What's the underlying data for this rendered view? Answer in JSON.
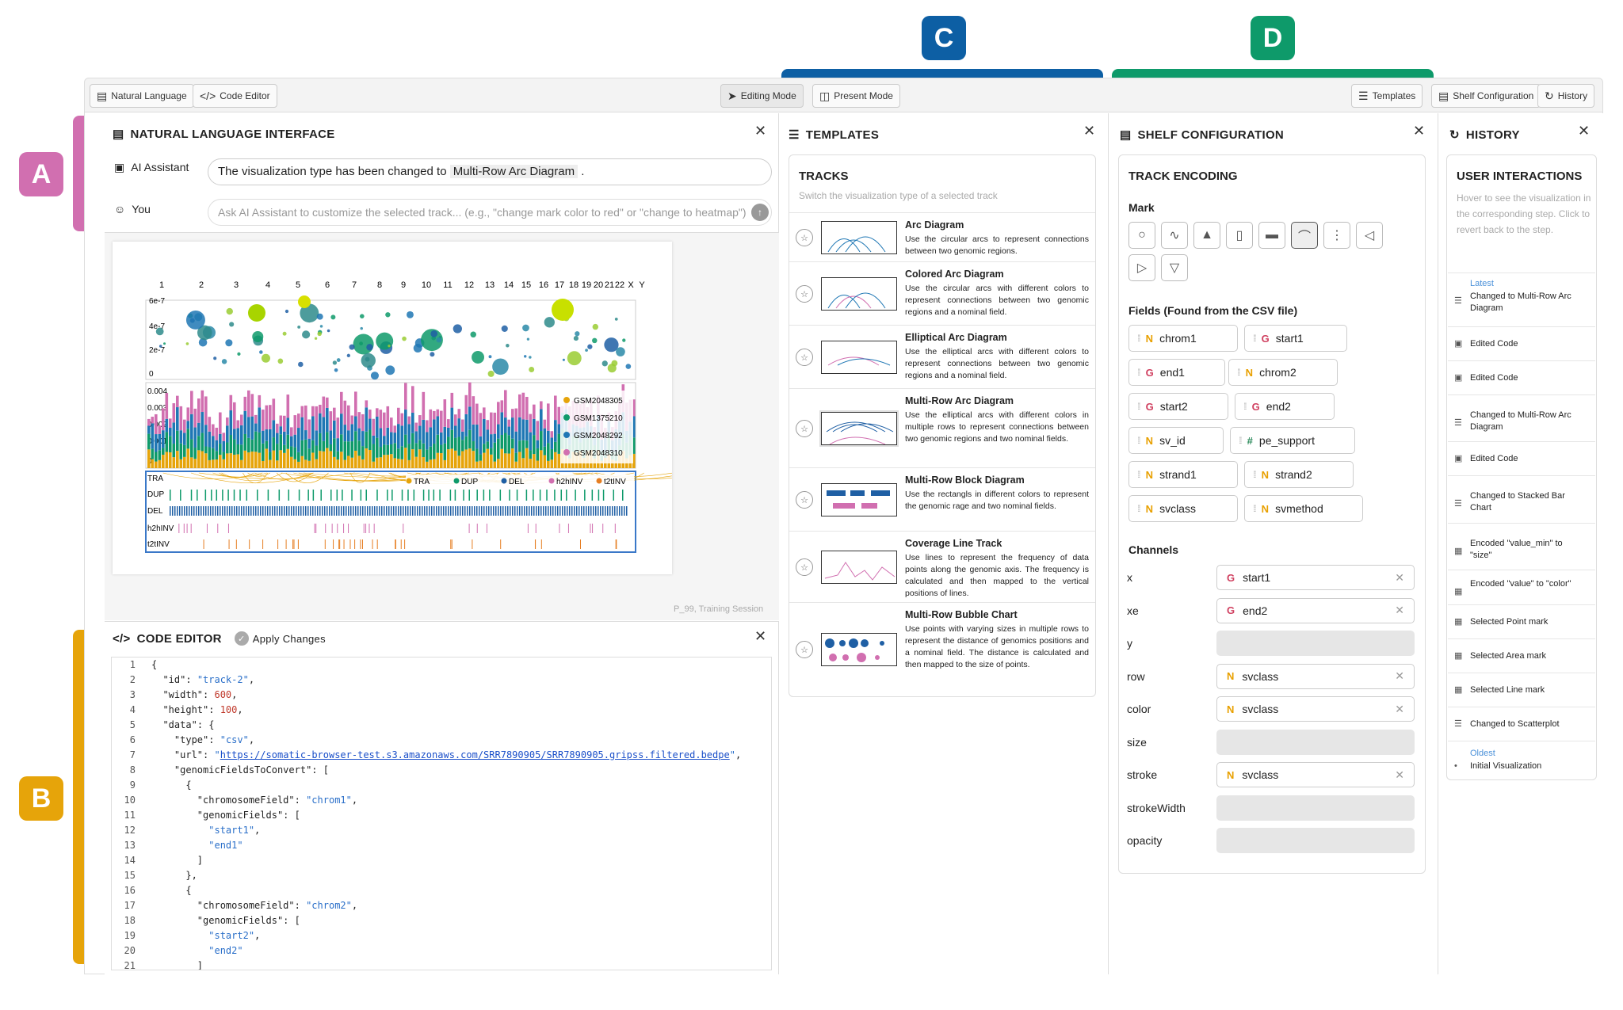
{
  "badges": {
    "a": "A",
    "b": "B",
    "c": "C",
    "d": "D"
  },
  "colors": {
    "pink": "#d16fb0",
    "orange": "#e6a40a",
    "blue": "#0d5fa4",
    "green": "#0e9a6a"
  },
  "toolbar": {
    "natural_language": "Natural Language",
    "code_editor": "Code Editor",
    "editing_mode": "Editing Mode",
    "present_mode": "Present Mode",
    "templates": "Templates",
    "shelf_configuration": "Shelf Configuration",
    "history": "History"
  },
  "nli": {
    "title": "NATURAL LANGUAGE INTERFACE",
    "assistant_label": "AI Assistant",
    "assistant_message_prefix": "The visualization type has been changed to",
    "assistant_message_highlight": "Multi-Row Arc Diagram",
    "assistant_message_suffix": ".",
    "you_label": "You",
    "input_placeholder": "Ask AI Assistant to customize the selected track... (e.g., \"change mark color to red\" or \"change to heatmap\")",
    "session_label": "P_99, Training Session"
  },
  "viz": {
    "chrom_ticks": [
      "1",
      "2",
      "3",
      "4",
      "5",
      "6",
      "7",
      "8",
      "9",
      "10",
      "11",
      "12",
      "13",
      "14",
      "15",
      "16",
      "17",
      "18",
      "19",
      "20",
      "21",
      "22",
      "X",
      "Y"
    ],
    "bubble_y_ticks": [
      "6e-7",
      "4e-7",
      "2e-7",
      "0"
    ],
    "bar_y_ticks": [
      "0.004",
      "0.003",
      "0.002",
      "0.001",
      "0"
    ],
    "bar_legend": [
      "GSM2048305",
      "GSM1375210",
      "GSM2048292",
      "GSM2048310"
    ],
    "bar_legend_colors": [
      "#e6a40a",
      "#0e9a6a",
      "#1f77b4",
      "#d16fb0"
    ],
    "arc_legend": [
      "TRA",
      "DUP",
      "DEL",
      "h2hINV",
      "t2tINV"
    ],
    "arc_legend_colors": [
      "#e6a40a",
      "#0e9a6a",
      "#1f5fa4",
      "#d16fb0",
      "#e67e22"
    ],
    "row_labels": [
      "TRA",
      "DUP",
      "DEL",
      "h2hINV",
      "t2tINV"
    ]
  },
  "code_editor": {
    "title": "CODE EDITOR",
    "apply_label": "Apply Changes",
    "lines": [
      "{",
      "  \"id\": \"track-2\",",
      "  \"width\": 600,",
      "  \"height\": 100,",
      "  \"data\": {",
      "    \"type\": \"csv\",",
      "    \"url\": \"https://somatic-browser-test.s3.amazonaws.com/SRR7890905/SRR7890905.gripss.filtered.bedpe\",",
      "    \"genomicFieldsToConvert\": [",
      "      {",
      "        \"chromosomeField\": \"chrom1\",",
      "        \"genomicFields\": [",
      "          \"start1\",",
      "          \"end1\"",
      "        ]",
      "      },",
      "      {",
      "        \"chromosomeField\": \"chrom2\",",
      "        \"genomicFields\": [",
      "          \"start2\",",
      "          \"end2\"",
      "        ]"
    ]
  },
  "templates": {
    "title": "TEMPLATES",
    "section": "TRACKS",
    "section_desc": "Switch the visualization type of a selected track",
    "items": [
      {
        "title": "Arc Diagram",
        "desc": "Use the circular arcs to represent connections between two genomic regions."
      },
      {
        "title": "Colored Arc Diagram",
        "desc": "Use the circular arcs with different colors to represent connections between two genomic regions and a nominal field."
      },
      {
        "title": "Elliptical Arc Diagram",
        "desc": "Use the elliptical arcs with different colors to represent connections between two genomic regions and a nominal field."
      },
      {
        "title": "Multi-Row Arc Diagram",
        "desc": "Use the elliptical arcs with different colors in multiple rows to represent connections between two genomic regions and two nominal fields."
      },
      {
        "title": "Multi-Row Block Diagram",
        "desc": "Use the rectangls in different colors to represent the genomic rage and two nominal fields."
      },
      {
        "title": "Coverage Line Track",
        "desc": "Use lines to represent the frequency of data points along the genomic axis. The frequency is calculated and then mapped to the vertical positions of lines."
      },
      {
        "title": "Multi-Row Bubble Chart",
        "desc": "Use points with varying sizes in multiple rows to represent the distance of genomics positions and a nominal field. The distance is calculated and then mapped to the size of points."
      }
    ]
  },
  "shelf": {
    "title": "SHELF CONFIGURATION",
    "section": "TRACK ENCODING",
    "mark_label": "Mark",
    "fields_label": "Fields (Found from the CSV file)",
    "fields": [
      {
        "type": "N",
        "name": "chrom1"
      },
      {
        "type": "G",
        "name": "start1"
      },
      {
        "type": "G",
        "name": "end1"
      },
      {
        "type": "N",
        "name": "chrom2"
      },
      {
        "type": "G",
        "name": "start2"
      },
      {
        "type": "G",
        "name": "end2"
      },
      {
        "type": "N",
        "name": "sv_id"
      },
      {
        "type": "#",
        "name": "pe_support"
      },
      {
        "type": "N",
        "name": "strand1"
      },
      {
        "type": "N",
        "name": "strand2"
      },
      {
        "type": "N",
        "name": "svclass"
      },
      {
        "type": "N",
        "name": "svmethod"
      }
    ],
    "channels_label": "Channels",
    "channels": [
      {
        "name": "x",
        "type": "G",
        "value": "start1"
      },
      {
        "name": "xe",
        "type": "G",
        "value": "end2"
      },
      {
        "name": "y",
        "type": "",
        "value": ""
      },
      {
        "name": "row",
        "type": "N",
        "value": "svclass"
      },
      {
        "name": "color",
        "type": "N",
        "value": "svclass"
      },
      {
        "name": "size",
        "type": "",
        "value": ""
      },
      {
        "name": "stroke",
        "type": "N",
        "value": "svclass"
      },
      {
        "name": "strokeWidth",
        "type": "",
        "value": ""
      },
      {
        "name": "opacity",
        "type": "",
        "value": ""
      }
    ]
  },
  "history": {
    "title": "HISTORY",
    "section": "USER INTERACTIONS",
    "section_desc": "Hover to see the visualization in the corresponding step. Click to revert back to the step.",
    "latest_label": "Latest",
    "oldest_label": "Oldest",
    "items": [
      "Changed to Multi-Row Arc Diagram",
      "Edited Code",
      "Edited Code",
      "Changed to Multi-Row Arc Diagram",
      "Edited Code",
      "Changed to Stacked Bar Chart",
      "Encoded \"value_min\" to \"size\"",
      "Encoded \"value\" to \"color\"",
      "Selected Point mark",
      "Selected Area mark",
      "Selected Line mark",
      "Changed to Scatterplot",
      "Initial Visualization"
    ]
  }
}
